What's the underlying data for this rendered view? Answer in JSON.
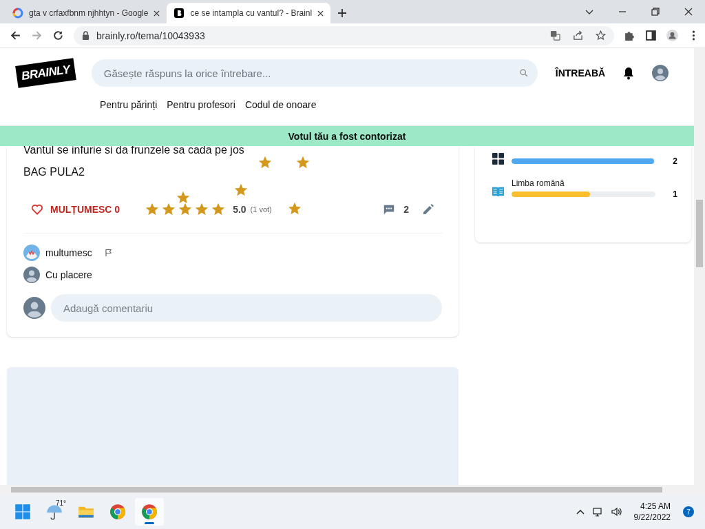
{
  "browser": {
    "tabs": [
      {
        "title": "gta v crfaxfbnm njhhtyn - Google",
        "kind": "google",
        "selected": false
      },
      {
        "title": "ce se intampla cu vantul? - Brainl",
        "kind": "brainly",
        "selected": true
      }
    ],
    "address": "brainly.ro/tema/10043933"
  },
  "header": {
    "logo": "BRAINLY",
    "search": {
      "placeholder": "Găsește răspuns la orice întrebare..."
    },
    "ask_button": "ÎNTREABĂ",
    "nav": [
      "Pentru părinți",
      "Pentru profesori",
      "Codul de onoare"
    ]
  },
  "banner": "Votul tău a fost contorizat",
  "answer": {
    "lines": [
      "Vantul se infurie si da frunzele sa cada pe jos",
      "BAG PULA2"
    ],
    "thanks": "MULȚUMESC 0",
    "stars": 5,
    "rating": "5.0",
    "votes": "(1 vot)",
    "comments_count": "2",
    "comments": [
      {
        "text": "multumesc",
        "kind": "mascot",
        "flag": true
      },
      {
        "text": "Cu placere",
        "kind": "default",
        "flag": false
      }
    ],
    "comment_field": {
      "placeholder": "Adaugă comentariu"
    }
  },
  "sidebar": {
    "subjects": [
      {
        "kind": "calculator",
        "level": 1,
        "count": "2",
        "color": "#4fa8f0"
      },
      {
        "name": "Limba română",
        "kind": "book",
        "level": 0.55,
        "count": "1",
        "color": "#fbbe2e"
      }
    ]
  },
  "taskbar": {
    "apps": [
      {
        "kind": "start",
        "selected": false
      },
      {
        "kind": "weather",
        "label": "71°",
        "selected": false
      },
      {
        "kind": "folder",
        "selected": false
      },
      {
        "kind": "chrome",
        "selected": false
      },
      {
        "kind": "chrome",
        "selected": true
      }
    ],
    "time": "4:25 AM",
    "date": "9/22/2022",
    "notifications": "7"
  }
}
